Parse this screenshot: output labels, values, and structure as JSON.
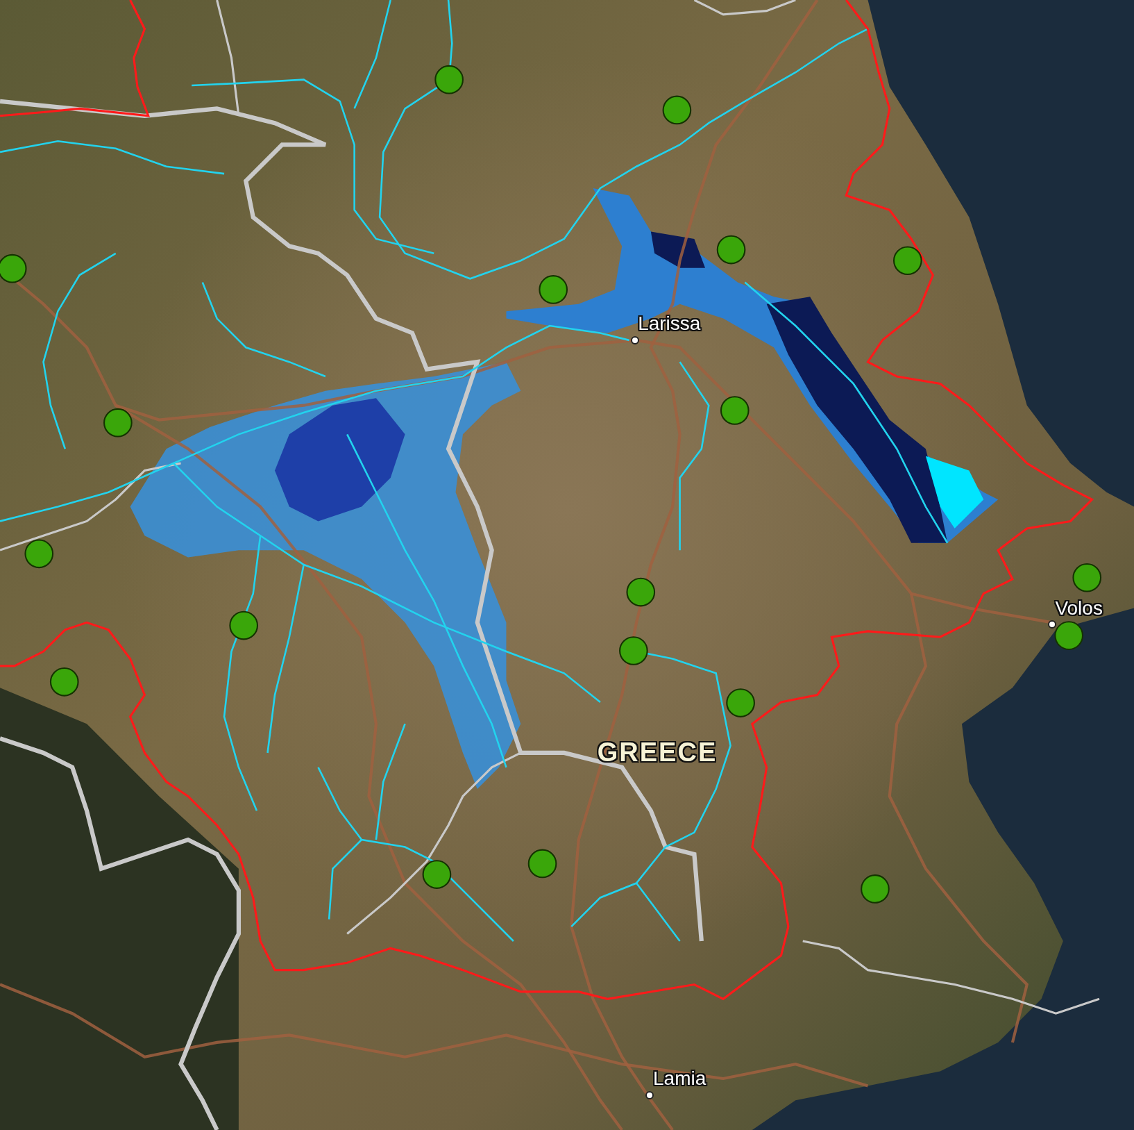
{
  "map": {
    "labels": [
      {
        "kind": "city",
        "text": "Larissa"
      },
      {
        "kind": "city",
        "text": "Volos"
      },
      {
        "kind": "country",
        "text": "GREECE"
      },
      {
        "kind": "city",
        "text": "Lamia"
      }
    ]
  }
}
